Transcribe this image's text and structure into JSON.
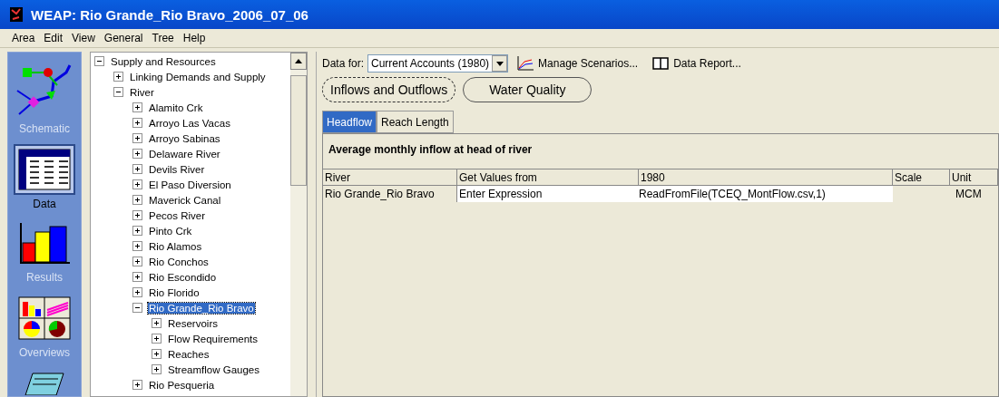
{
  "window": {
    "title": "WEAP: Rio Grande_Rio Bravo_2006_07_06"
  },
  "menu": [
    "Area",
    "Edit",
    "View",
    "General",
    "Tree",
    "Help"
  ],
  "sidebar": {
    "items": [
      {
        "kind": "schematic",
        "label": "Schematic",
        "selected": false
      },
      {
        "kind": "data",
        "label": "Data",
        "selected": true
      },
      {
        "kind": "results",
        "label": "Results",
        "selected": false
      },
      {
        "kind": "overviews",
        "label": "Overviews",
        "selected": false
      },
      {
        "kind": "notes",
        "selected": false
      }
    ]
  },
  "tree": [
    {
      "label": "Supply and Resources",
      "expanded": true,
      "selected": false,
      "children": [
        {
          "label": "Linking Demands and Supply",
          "expanded": false,
          "selected": false
        },
        {
          "label": "River",
          "expanded": true,
          "selected": false,
          "children": [
            {
              "label": "Alamito Crk",
              "expanded": false,
              "selected": false
            },
            {
              "label": "Arroyo Las Vacas",
              "expanded": false,
              "selected": false
            },
            {
              "label": "Arroyo Sabinas",
              "expanded": false,
              "selected": false
            },
            {
              "label": "Delaware River",
              "expanded": false,
              "selected": false
            },
            {
              "label": "Devils River",
              "expanded": false,
              "selected": false
            },
            {
              "label": "El Paso Diversion",
              "expanded": false,
              "selected": false
            },
            {
              "label": "Maverick Canal",
              "expanded": false,
              "selected": false
            },
            {
              "label": "Pecos River",
              "expanded": false,
              "selected": false
            },
            {
              "label": "Pinto Crk",
              "expanded": false,
              "selected": false
            },
            {
              "label": "Rio Alamos",
              "expanded": false,
              "selected": false
            },
            {
              "label": "Rio Conchos",
              "expanded": false,
              "selected": false
            },
            {
              "label": "Rio Escondido",
              "expanded": false,
              "selected": false
            },
            {
              "label": "Rio Florido",
              "expanded": false,
              "selected": false
            },
            {
              "label": "Rio Grande_Rio Bravo",
              "expanded": true,
              "selected": true,
              "children": [
                {
                  "label": "Reservoirs",
                  "expanded": false,
                  "selected": false
                },
                {
                  "label": "Flow Requirements",
                  "expanded": false,
                  "selected": false
                },
                {
                  "label": "Reaches",
                  "expanded": false,
                  "selected": false
                },
                {
                  "label": "Streamflow Gauges",
                  "expanded": false,
                  "selected": false
                }
              ]
            },
            {
              "label": "Rio Pesqueria",
              "expanded": false,
              "selected": false
            }
          ]
        }
      ]
    }
  ],
  "toolbar": {
    "data_for_label": "Data for:",
    "data_for_value": "Current Accounts (1980)",
    "manage_scenarios": "Manage Scenarios...",
    "data_report": "Data Report..."
  },
  "categories": [
    {
      "label": "Inflows and Outflows",
      "selected": true
    },
    {
      "label": "Water Quality",
      "selected": false
    }
  ],
  "tabs": [
    {
      "label": "Headflow",
      "selected": true
    },
    {
      "label": "Reach Length",
      "selected": false
    }
  ],
  "panel_title": "Average monthly inflow at head of river",
  "table": {
    "columns": [
      "River",
      "Get Values from",
      "1980",
      "Scale",
      "Unit"
    ],
    "rows": [
      [
        "Rio Grande_Rio Bravo",
        "Enter Expression",
        "ReadFromFile(TCEQ_MontFlow.csv,1)",
        "",
        "MCM"
      ]
    ]
  }
}
